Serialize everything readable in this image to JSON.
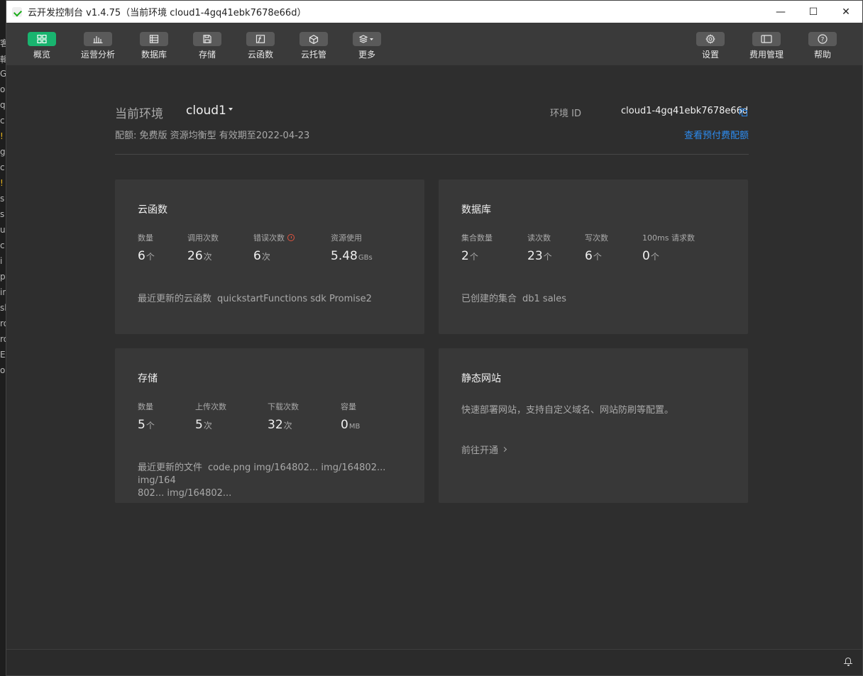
{
  "background_fragments": [
    "客",
    "輯",
    "G",
    "o",
    "q",
    "c",
    "!",
    "g",
    "c",
    "!",
    "s",
    "s",
    "u",
    "c",
    "i",
    "p",
    "in",
    "sl",
    "ro",
    "ro",
    "EA",
    "ol"
  ],
  "window": {
    "title": "云开发控制台 v1.4.75（当前环境 cloud1-4gq41ebk7678e66d）",
    "controls": {
      "minimize": "—",
      "maximize": "☐",
      "close": "✕"
    }
  },
  "toolbar": {
    "left": [
      {
        "label": "概览",
        "icon": "overview-grid-icon",
        "active": true
      },
      {
        "label": "运营分析",
        "icon": "bar-chart-icon",
        "active": false
      },
      {
        "label": "数据库",
        "icon": "database-icon",
        "active": false
      },
      {
        "label": "存储",
        "icon": "storage-icon",
        "active": false
      },
      {
        "label": "云函数",
        "icon": "function-icon",
        "active": false
      },
      {
        "label": "云托管",
        "icon": "cube-icon",
        "active": false
      },
      {
        "label": "更多",
        "icon": "layers-icon",
        "active": false
      }
    ],
    "right": [
      {
        "label": "设置",
        "icon": "gear-icon"
      },
      {
        "label": "费用管理",
        "icon": "billing-icon"
      },
      {
        "label": "帮助",
        "icon": "help-icon"
      }
    ]
  },
  "env": {
    "label": "当前环境",
    "name": "cloud1",
    "quota": "配额: 免费版 资源均衡型 有效期至2022-04-23",
    "id_label": "环境 ID",
    "id_value": "cloud1-4gq41ebk7678e66d",
    "price_link": "查看预付费配额"
  },
  "cards": {
    "functions": {
      "title": "云函数",
      "stats": [
        {
          "label": "数量",
          "value": "6",
          "unit": "个"
        },
        {
          "label": "调用次数",
          "value": "26",
          "unit": "次"
        },
        {
          "label": "错误次数",
          "value": "6",
          "unit": "次"
        },
        {
          "label": "资源使用",
          "value": "5.48",
          "unit": "GBs"
        }
      ],
      "footer_label": "最近更新的云函数",
      "footer_value": "quickstartFunctions sdk Promise2"
    },
    "database": {
      "title": "数据库",
      "stats": [
        {
          "label": "集合数量",
          "value": "2",
          "unit": "个"
        },
        {
          "label": "读次数",
          "value": "23",
          "unit": "个"
        },
        {
          "label": "写次数",
          "value": "6",
          "unit": "个"
        },
        {
          "label": "100ms 请求数",
          "value": "0",
          "unit": "个"
        }
      ],
      "footer_label": "已创建的集合",
      "footer_value": "db1 sales"
    },
    "storage": {
      "title": "存储",
      "stats": [
        {
          "label": "数量",
          "value": "5",
          "unit": "个"
        },
        {
          "label": "上传次数",
          "value": "5",
          "unit": "次"
        },
        {
          "label": "下载次数",
          "value": "32",
          "unit": "次"
        },
        {
          "label": "容量",
          "value": "0",
          "unit": "MB"
        }
      ],
      "footer_label": "最近更新的文件",
      "footer_line1": "code.png img/164802... img/164802... img/164",
      "footer_line2": "802... img/164802..."
    },
    "static_site": {
      "title": "静态网站",
      "desc": "快速部署网站，支持自定义域名、网站防刷等配置。",
      "link": "前往开通"
    }
  }
}
